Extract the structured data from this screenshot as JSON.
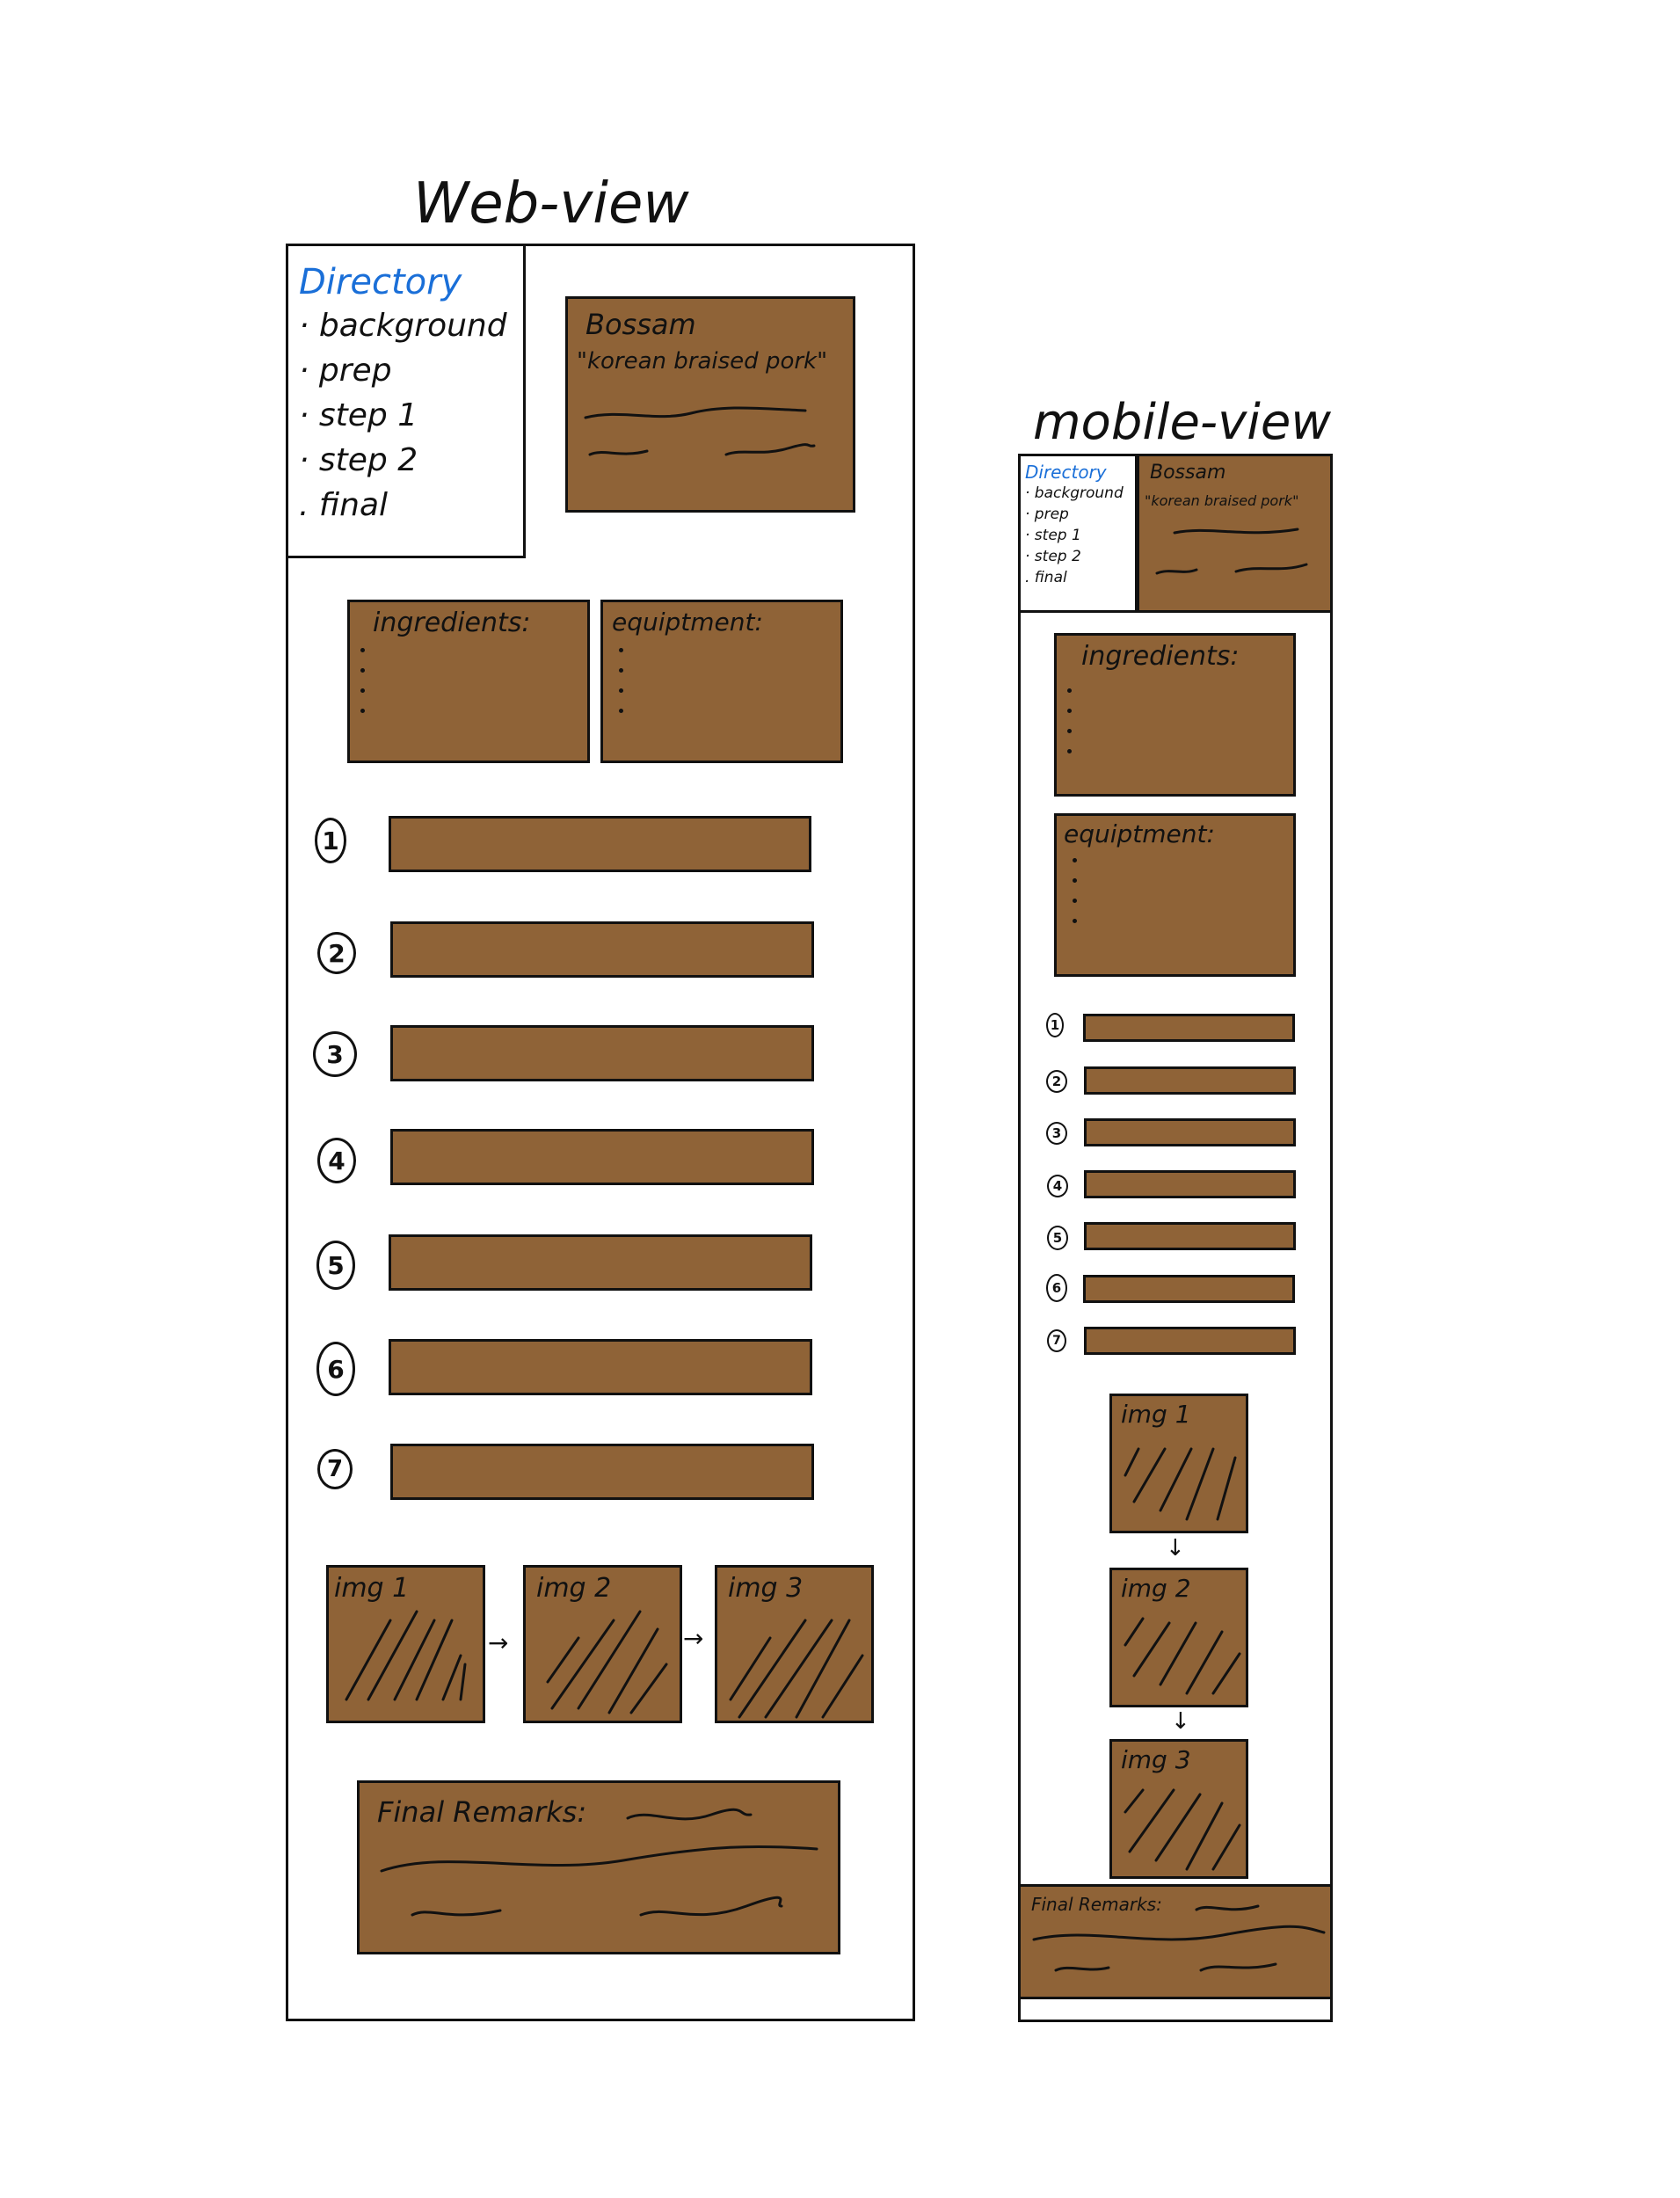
{
  "web": {
    "heading": "Web-view",
    "directory": {
      "title": "Directory",
      "items": [
        "· background",
        "· prep",
        "· step 1",
        "· step 2",
        ". final"
      ]
    },
    "hero": {
      "title": "Bossam",
      "subtitle": "\"korean braised pork\""
    },
    "ingredients_label": "ingredients:",
    "equipment_label": "equiptment:",
    "steps": [
      "1",
      "2",
      "3",
      "4",
      "5",
      "6",
      "7"
    ],
    "images": [
      "img 1",
      "img 2",
      "img 3"
    ],
    "arrow": "→",
    "final_label": "Final Remarks:"
  },
  "mobile": {
    "heading": "mobile-view",
    "directory": {
      "title": "Directory",
      "items": [
        "· background",
        "· prep",
        "· step 1",
        "· step 2",
        ". final"
      ]
    },
    "hero": {
      "title": "Bossam",
      "subtitle": "\"korean braised pork\""
    },
    "ingredients_label": "ingredients:",
    "equipment_label": "equiptment:",
    "steps": [
      "1",
      "2",
      "3",
      "4",
      "5",
      "6",
      "7"
    ],
    "images": [
      "img 1",
      "img 2",
      "img 3"
    ],
    "arrow": "↓",
    "final_label": "Final Remarks:"
  },
  "colors": {
    "box_fill": "#8f6337",
    "directory_title": "#1a6fd8",
    "outline": "#111111"
  }
}
